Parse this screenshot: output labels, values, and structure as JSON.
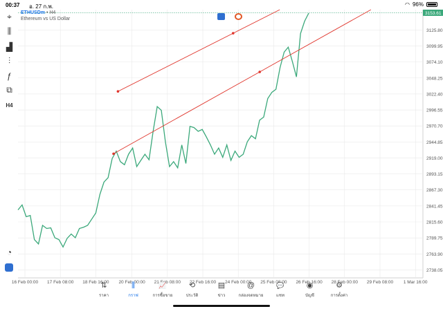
{
  "status": {
    "time": "00:37",
    "date": "อ. 27 ก.พ.",
    "battery": "96%"
  },
  "header": {
    "symbol": "ETHUSDm",
    "timeframe": "• H4",
    "description": "Ethereum vs US Dollar"
  },
  "toolbar": {
    "items": [
      {
        "icon": "crosshair-icon",
        "glyph": "⌖"
      },
      {
        "icon": "candlestick-icon",
        "glyph": "⫼"
      },
      {
        "icon": "bar-chart-icon",
        "glyph": "▟"
      },
      {
        "icon": "indicators-icon",
        "glyph": "⫶"
      },
      {
        "icon": "function-icon",
        "glyph": "ƒ"
      },
      {
        "icon": "objects-icon",
        "glyph": "⧉"
      },
      {
        "icon": "timeframe-label",
        "glyph": "H4"
      }
    ]
  },
  "chart_data": {
    "type": "line",
    "current_price": "3153.61",
    "y_ticks": [
      "3125.80",
      "3099.95",
      "3074.10",
      "3048.25",
      "3022.40",
      "2996.55",
      "2970.70",
      "2944.85",
      "2919.00",
      "2893.15",
      "2867.30",
      "2841.45",
      "2815.60",
      "2789.75",
      "2763.90",
      "2738.05"
    ],
    "x_ticks": [
      "16 Feb 00:00",
      "17 Feb 08:00",
      "18 Feb 16:00",
      "20 Feb 00:00",
      "21 Feb 08:00",
      "22 Feb 16:00",
      "24 Feb 00:00",
      "25 Feb 08:00",
      "26 Feb 16:00",
      "28 Feb 00:00",
      "29 Feb 08:00",
      "1 Mar 16:00"
    ],
    "ylim": [
      2725.125,
      3158.575
    ],
    "series": [
      {
        "color": "#3aa87a",
        "values": [
          2835,
          2843,
          2824,
          2826,
          2787,
          2780,
          2810,
          2805,
          2806,
          2790,
          2787,
          2775,
          2789,
          2796,
          2790,
          2805,
          2807,
          2810,
          2820,
          2830,
          2860,
          2880,
          2887,
          2918,
          2930,
          2913,
          2908,
          2925,
          2935,
          2905,
          2915,
          2925,
          2916,
          2962,
          3002,
          2996,
          2945,
          2905,
          2913,
          2903,
          2940,
          2910,
          2970,
          2968,
          2962,
          2965,
          2953,
          2940,
          2925,
          2935,
          2920,
          2940,
          2915,
          2930,
          2920,
          2925,
          2945,
          2955,
          2950,
          2980,
          2985,
          3015,
          3025,
          3030,
          3065,
          3090,
          3098,
          3075,
          3050,
          3120,
          3140,
          3153
        ]
      }
    ],
    "trendlines": [
      {
        "color": "#e0362d",
        "points": [
          [
            "19 Feb 12:00",
            3026.5
          ],
          [
            "23 Feb 20:00",
            3120.5
          ]
        ]
      },
      {
        "color": "#e0362d",
        "points": [
          [
            "19 Feb 08:00",
            2925.8
          ],
          [
            "24 Feb 20:00",
            3058.0
          ]
        ]
      }
    ]
  },
  "bottom_nav": [
    {
      "label": "ราคา",
      "glyph": "⇅",
      "icon": "quotes-icon"
    },
    {
      "label": "กราฟ",
      "glyph": "⫼",
      "icon": "chart-icon",
      "active": true
    },
    {
      "label": "การซื้อขาย",
      "glyph": "📈",
      "icon": "trade-icon"
    },
    {
      "label": "ประวัติ",
      "glyph": "⟲",
      "icon": "history-icon"
    },
    {
      "label": "ข่าว",
      "glyph": "▤",
      "icon": "news-icon"
    },
    {
      "label": "กล่องจดหมาย",
      "glyph": "@",
      "icon": "mailbox-icon"
    },
    {
      "label": "แชท",
      "glyph": "💬",
      "icon": "chat-icon"
    },
    {
      "label": "บัญชี",
      "glyph": "◉",
      "icon": "account-icon"
    },
    {
      "label": "การตั้งค่า",
      "glyph": "⚙",
      "icon": "settings-icon"
    }
  ],
  "colors": {
    "accent": "#1a73e8",
    "price_line": "#3aa87a",
    "trend": "#e0362d",
    "grid": "#e9e9e9"
  }
}
